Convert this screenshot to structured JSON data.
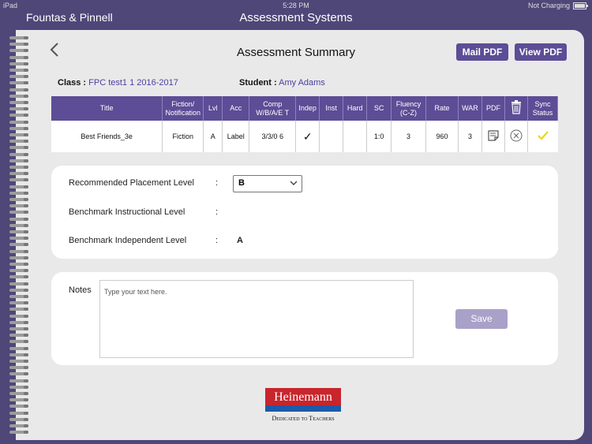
{
  "status": {
    "device": "iPad",
    "time": "5:28 PM",
    "battery": "Not Charging"
  },
  "app": {
    "brand": "Fountas & Pinnell",
    "title": "Assessment Systems"
  },
  "header": {
    "title": "Assessment Summary",
    "mail_pdf": "Mail PDF",
    "view_pdf": "View PDF"
  },
  "info": {
    "class_label": "Class :",
    "class_value": "FPC test1 1 2016-2017",
    "student_label": "Student :",
    "student_value": "Amy Adams"
  },
  "table": {
    "headers": [
      "Title",
      "Fiction/ Notification",
      "Lvl",
      "Acc",
      "Comp W/B/A/E T",
      "Indep",
      "Inst",
      "Hard",
      "SC",
      "Fluency (C-Z)",
      "Rate",
      "WAR",
      "PDF",
      "",
      "Sync Status"
    ],
    "row": {
      "title": "Best Friends_3e",
      "genre": "Fiction",
      "lvl": "A",
      "acc": "Label",
      "comp": "3/3/0  6",
      "indep": "✓",
      "inst": "",
      "hard": "",
      "sc": "1:0",
      "fluency": "3",
      "rate": "960",
      "war": "3"
    }
  },
  "placement": {
    "recommended_label": "Recommended Placement Level",
    "recommended_value": "B",
    "instructional_label": "Benchmark Instructional Level",
    "instructional_value": "",
    "independent_label": "Benchmark Independent Level",
    "independent_value": "A",
    "colon": ":"
  },
  "notes": {
    "label": "Notes",
    "placeholder": "Type your text here.",
    "save": "Save"
  },
  "footer": {
    "logo_text": "Heinemann",
    "tagline": "Dedicated to Teachers"
  },
  "colors": {
    "accent": "#5c4d96",
    "background": "#4e4778",
    "paper": "#e9e9ea",
    "sync_check": "#e6d81c"
  }
}
